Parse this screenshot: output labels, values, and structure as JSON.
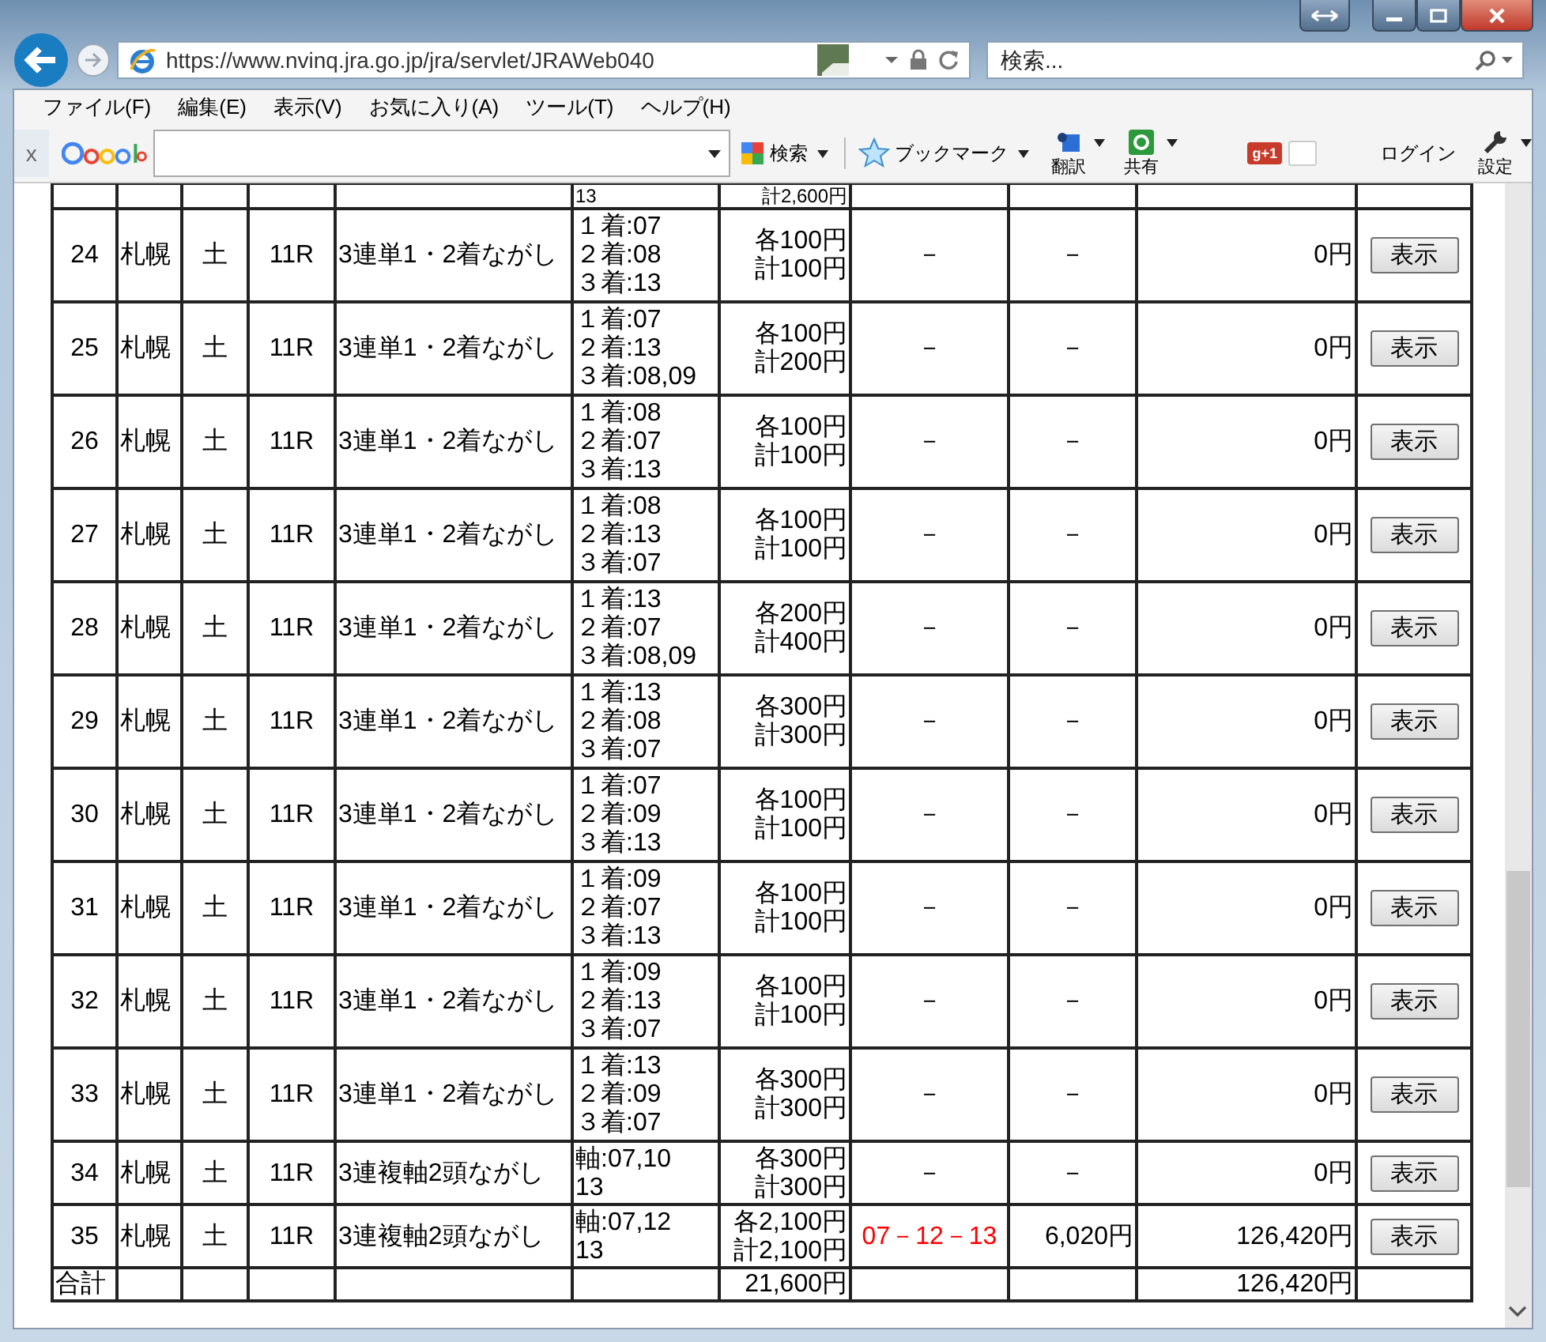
{
  "browser": {
    "url": "https://www.nvinq.jra.go.jp/jra/servlet/JRAWeb040",
    "search": {
      "placeholder": "検索..."
    }
  },
  "menu": [
    "ファイル(F)",
    "編集(E)",
    "表示(V)",
    "お気に入り(A)",
    "ツール(T)",
    "ヘルプ(H)"
  ],
  "toolbar": {
    "close": "x",
    "items": [
      {
        "kind": "search",
        "label": "検索"
      },
      {
        "kind": "bookmark",
        "label": "ブックマーク"
      },
      {
        "kind": "translate",
        "label": "翻訳"
      },
      {
        "kind": "share",
        "label": "共有"
      },
      {
        "kind": "plusone",
        "label": "g+1"
      },
      {
        "kind": "login",
        "label": "ログイン"
      },
      {
        "kind": "settings",
        "label": "設定"
      }
    ]
  },
  "partial_row": {
    "bets": "13",
    "amount": "計2,600円"
  },
  "rows": [
    {
      "no": "24",
      "place": "札幌",
      "day": "土",
      "race": "11R",
      "type": "3連単1・2着ながし",
      "bets": [
        "１着:07",
        "２着:08",
        "３着:13"
      ],
      "amount": [
        "各100円",
        "計100円"
      ],
      "result": "－",
      "hit": false,
      "payout": "－",
      "refund": "0円",
      "button": "表示"
    },
    {
      "no": "25",
      "place": "札幌",
      "day": "土",
      "race": "11R",
      "type": "3連単1・2着ながし",
      "bets": [
        "１着:07",
        "２着:13",
        "３着:08,09"
      ],
      "amount": [
        "各100円",
        "計200円"
      ],
      "result": "－",
      "hit": false,
      "payout": "－",
      "refund": "0円",
      "button": "表示"
    },
    {
      "no": "26",
      "place": "札幌",
      "day": "土",
      "race": "11R",
      "type": "3連単1・2着ながし",
      "bets": [
        "１着:08",
        "２着:07",
        "３着:13"
      ],
      "amount": [
        "各100円",
        "計100円"
      ],
      "result": "－",
      "hit": false,
      "payout": "－",
      "refund": "0円",
      "button": "表示"
    },
    {
      "no": "27",
      "place": "札幌",
      "day": "土",
      "race": "11R",
      "type": "3連単1・2着ながし",
      "bets": [
        "１着:08",
        "２着:13",
        "３着:07"
      ],
      "amount": [
        "各100円",
        "計100円"
      ],
      "result": "－",
      "hit": false,
      "payout": "－",
      "refund": "0円",
      "button": "表示"
    },
    {
      "no": "28",
      "place": "札幌",
      "day": "土",
      "race": "11R",
      "type": "3連単1・2着ながし",
      "bets": [
        "１着:13",
        "２着:07",
        "３着:08,09"
      ],
      "amount": [
        "各200円",
        "計400円"
      ],
      "result": "－",
      "hit": false,
      "payout": "－",
      "refund": "0円",
      "button": "表示"
    },
    {
      "no": "29",
      "place": "札幌",
      "day": "土",
      "race": "11R",
      "type": "3連単1・2着ながし",
      "bets": [
        "１着:13",
        "２着:08",
        "３着:07"
      ],
      "amount": [
        "各300円",
        "計300円"
      ],
      "result": "－",
      "hit": false,
      "payout": "－",
      "refund": "0円",
      "button": "表示"
    },
    {
      "no": "30",
      "place": "札幌",
      "day": "土",
      "race": "11R",
      "type": "3連単1・2着ながし",
      "bets": [
        "１着:07",
        "２着:09",
        "３着:13"
      ],
      "amount": [
        "各100円",
        "計100円"
      ],
      "result": "－",
      "hit": false,
      "payout": "－",
      "refund": "0円",
      "button": "表示"
    },
    {
      "no": "31",
      "place": "札幌",
      "day": "土",
      "race": "11R",
      "type": "3連単1・2着ながし",
      "bets": [
        "１着:09",
        "２着:07",
        "３着:13"
      ],
      "amount": [
        "各100円",
        "計100円"
      ],
      "result": "－",
      "hit": false,
      "payout": "－",
      "refund": "0円",
      "button": "表示"
    },
    {
      "no": "32",
      "place": "札幌",
      "day": "土",
      "race": "11R",
      "type": "3連単1・2着ながし",
      "bets": [
        "１着:09",
        "２着:13",
        "３着:07"
      ],
      "amount": [
        "各100円",
        "計100円"
      ],
      "result": "－",
      "hit": false,
      "payout": "－",
      "refund": "0円",
      "button": "表示"
    },
    {
      "no": "33",
      "place": "札幌",
      "day": "土",
      "race": "11R",
      "type": "3連単1・2着ながし",
      "bets": [
        "１着:13",
        "２着:09",
        "３着:07"
      ],
      "amount": [
        "各300円",
        "計300円"
      ],
      "result": "－",
      "hit": false,
      "payout": "－",
      "refund": "0円",
      "button": "表示"
    },
    {
      "no": "34",
      "place": "札幌",
      "day": "土",
      "race": "11R",
      "type": "3連複軸2頭ながし",
      "bets": [
        "軸:07,10",
        "13"
      ],
      "amount": [
        "各300円",
        "計300円"
      ],
      "result": "－",
      "hit": false,
      "payout": "－",
      "refund": "0円",
      "button": "表示"
    },
    {
      "no": "35",
      "place": "札幌",
      "day": "土",
      "race": "11R",
      "type": "3連複軸2頭ながし",
      "bets": [
        "軸:07,12",
        "13"
      ],
      "amount": [
        "各2,100円",
        "計2,100円"
      ],
      "result": "07－12－13",
      "hit": true,
      "payout": "6,020円",
      "refund": "126,420円",
      "button": "表示"
    }
  ],
  "total": {
    "label": "合計",
    "amount": "21,600円",
    "refund": "126,420円"
  }
}
